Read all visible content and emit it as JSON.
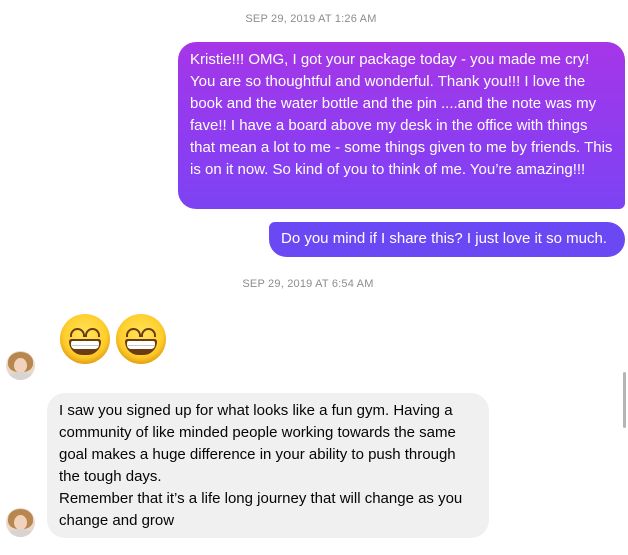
{
  "timestamps": {
    "first": "SEP 29, 2019 AT 1:26 AM",
    "second": "SEP 29, 2019 AT 6:54 AM"
  },
  "messages": {
    "outgoing_1": "Kristie!!! OMG, I got your package today - you made me cry! You are so thoughtful and wonderful. Thank you!!! I love the book and the water bottle and the pin ....and the note was my fave!! I have a board above my desk in the office with things that mean a lot to me - some things given to me by friends. This is on it now. So kind of you to think of me. You’re amazing!!!",
    "outgoing_2": "Do you mind if I share this? I just love it so much.",
    "incoming_1": "I saw you signed up for what looks like a fun gym. Having a community of like minded people working towards the same goal makes a huge difference in your ability to push through the tough days.\nRemember that it’s a life long journey that will change as you change and grow"
  },
  "reactions": {
    "emoji_name": "beaming-face-with-smiling-eyes",
    "count": 2
  },
  "colors": {
    "outgoing_gradient_top": "#a636e8",
    "outgoing_gradient_bottom": "#7c43f3",
    "outgoing_solid": "#6a49f5",
    "incoming_bg": "#f0f0f0",
    "timestamp": "#8a8d91"
  }
}
